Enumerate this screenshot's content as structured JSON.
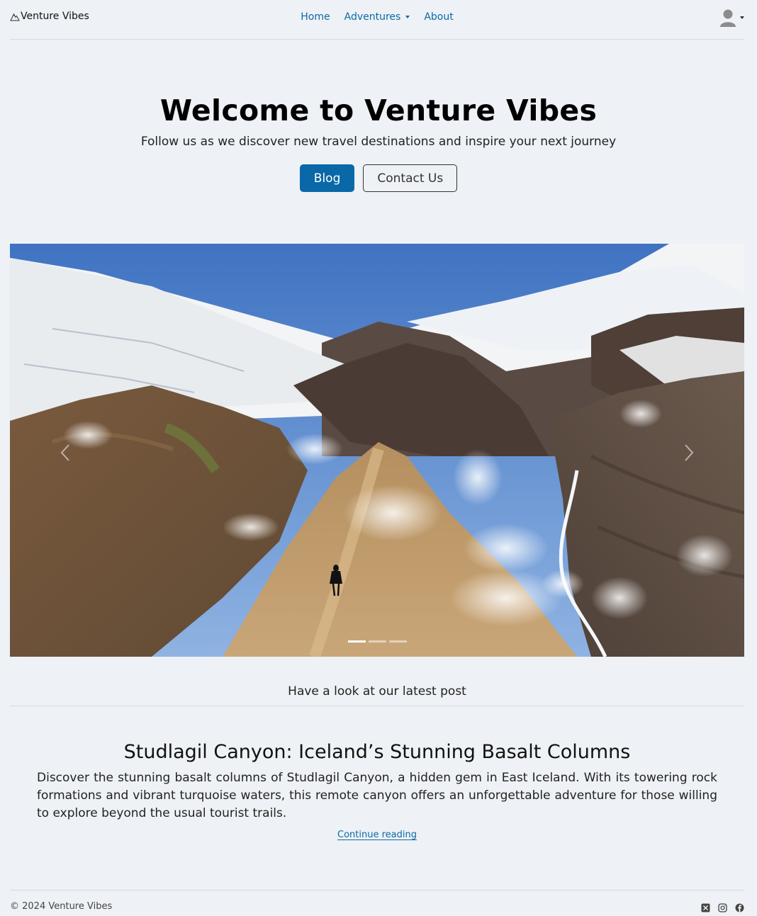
{
  "nav": {
    "brand": "Venture Vibes",
    "links": [
      {
        "label": "Home"
      },
      {
        "label": "Adventures"
      },
      {
        "label": "About"
      }
    ]
  },
  "hero": {
    "title": "Welcome to Venture Vibes",
    "subtitle": "Follow us as we discover new travel destinations and inspire your next journey",
    "primary_button": "Blog",
    "secondary_button": "Contact Us"
  },
  "carousel": {
    "slide_count": 3,
    "active_index": 0
  },
  "latest": {
    "heading": "Have a look at our latest post",
    "post_title": "Studlagil Canyon: Iceland’s Stunning Basalt Columns",
    "post_excerpt": "Discover the stunning basalt columns of Studlagil Canyon, a hidden gem in East Iceland. With its towering rock formations and vibrant turquoise waters, this remote canyon offers an unforgettable adventure for those willing to explore beyond the usual tourist trails.",
    "read_more": "Continue reading"
  },
  "footer": {
    "copyright": "© 2024 Venture Vibes",
    "social_icons": [
      "x-twitter-icon",
      "instagram-icon",
      "facebook-icon"
    ]
  },
  "colors": {
    "background": "#eef1f5",
    "link": "#0b6aa6",
    "primary": "#0a68a8"
  }
}
